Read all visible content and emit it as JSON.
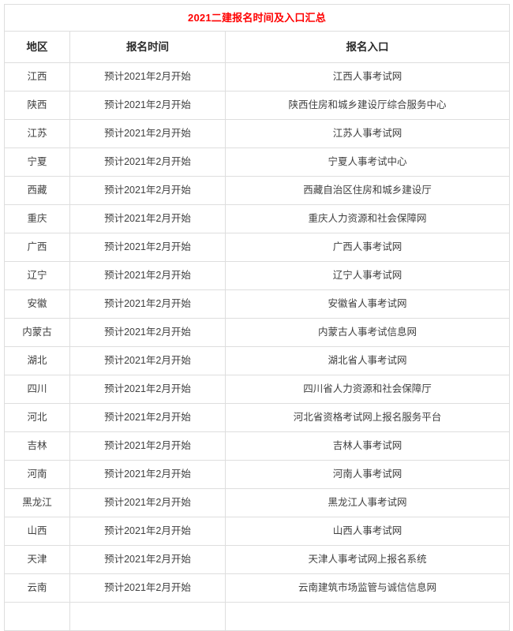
{
  "document": {
    "title": "2021二建报名时间及入口汇总"
  },
  "table": {
    "columns": [
      {
        "key": "region",
        "label": "地区"
      },
      {
        "key": "time",
        "label": "报名时间"
      },
      {
        "key": "entry",
        "label": "报名入口"
      }
    ],
    "title_color": "#ff0000",
    "border_color": "#dedede",
    "text_color": "#404040",
    "header_text_color": "#2b2b2b",
    "rows": [
      {
        "region": "江西",
        "time": "预计2021年2月开始",
        "entry": "江西人事考试网"
      },
      {
        "region": "陕西",
        "time": "预计2021年2月开始",
        "entry": "陕西住房和城乡建设厅综合服务中心"
      },
      {
        "region": "江苏",
        "time": "预计2021年2月开始",
        "entry": "江苏人事考试网"
      },
      {
        "region": "宁夏",
        "time": "预计2021年2月开始",
        "entry": "宁夏人事考试中心"
      },
      {
        "region": "西藏",
        "time": "预计2021年2月开始",
        "entry": "西藏自治区住房和城乡建设厅"
      },
      {
        "region": "重庆",
        "time": "预计2021年2月开始",
        "entry": "重庆人力资源和社会保障网"
      },
      {
        "region": "广西",
        "time": "预计2021年2月开始",
        "entry": "广西人事考试网"
      },
      {
        "region": "辽宁",
        "time": "预计2021年2月开始",
        "entry": "辽宁人事考试网"
      },
      {
        "region": "安徽",
        "time": "预计2021年2月开始",
        "entry": "安徽省人事考试网"
      },
      {
        "region": "内蒙古",
        "time": "预计2021年2月开始",
        "entry": "内蒙古人事考试信息网"
      },
      {
        "region": "湖北",
        "time": "预计2021年2月开始",
        "entry": "湖北省人事考试网"
      },
      {
        "region": "四川",
        "time": "预计2021年2月开始",
        "entry": "四川省人力资源和社会保障厅"
      },
      {
        "region": "河北",
        "time": "预计2021年2月开始",
        "entry": "河北省资格考试网上报名服务平台"
      },
      {
        "region": "吉林",
        "time": "预计2021年2月开始",
        "entry": "吉林人事考试网"
      },
      {
        "region": "河南",
        "time": "预计2021年2月开始",
        "entry": "河南人事考试网"
      },
      {
        "region": "黑龙江",
        "time": "预计2021年2月开始",
        "entry": "黑龙江人事考试网"
      },
      {
        "region": "山西",
        "time": "预计2021年2月开始",
        "entry": "山西人事考试网"
      },
      {
        "region": "天津",
        "time": "预计2021年2月开始",
        "entry": "天津人事考试网上报名系统"
      },
      {
        "region": "云南",
        "time": "预计2021年2月开始",
        "entry": "云南建筑市场监管与诚信信息网"
      },
      {
        "region": "",
        "time": "",
        "entry": ""
      }
    ]
  }
}
